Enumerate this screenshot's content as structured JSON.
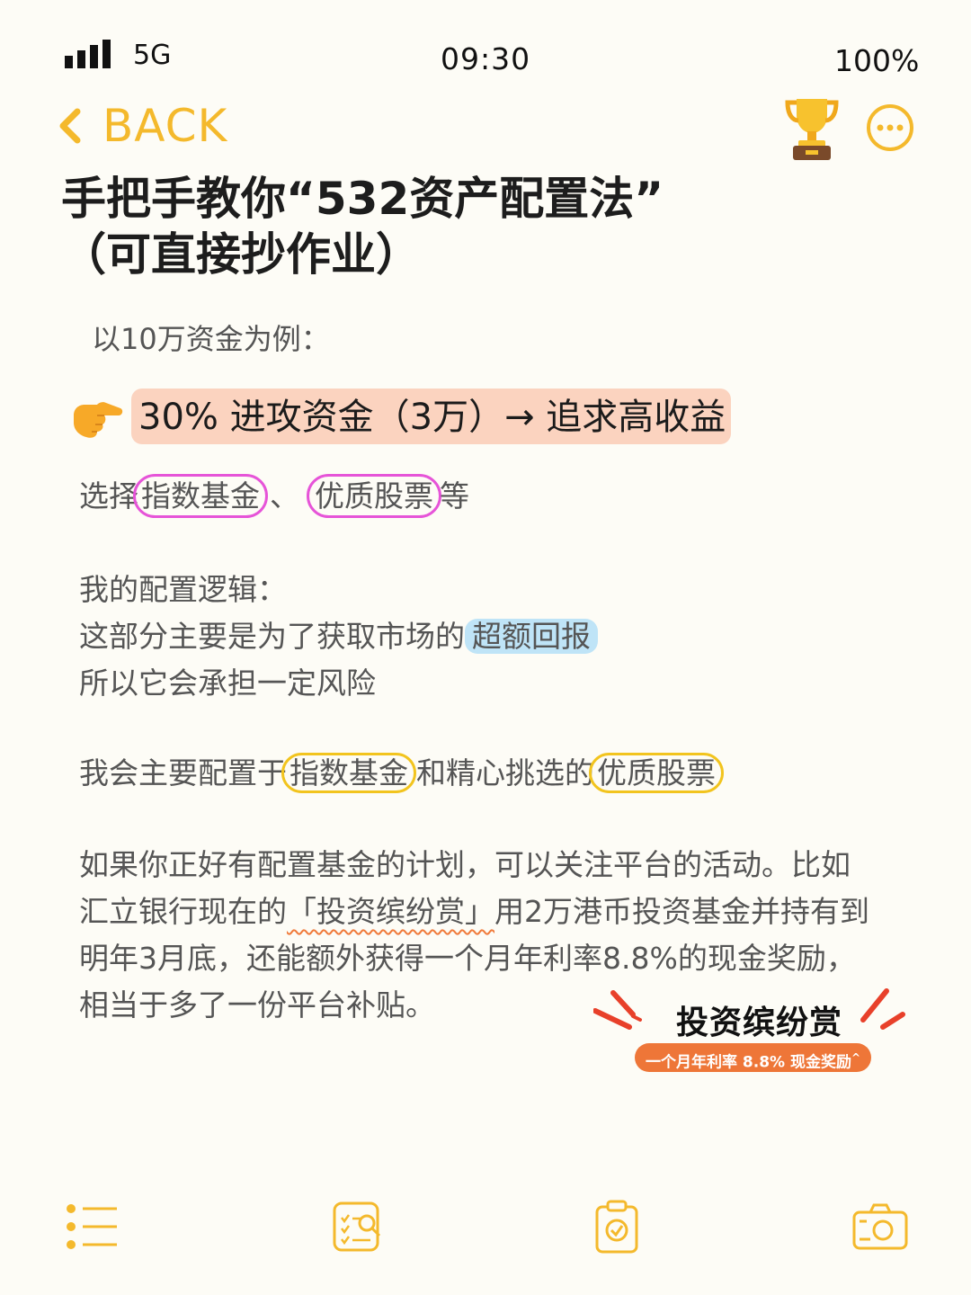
{
  "status_bar": {
    "network": "5G",
    "time": "09:30",
    "battery": "100%"
  },
  "nav": {
    "back_label": "BACK",
    "trophy_icon": "trophy-icon",
    "more_icon": "more-icon"
  },
  "title": {
    "line1": "手把手教你“532资产配置法”",
    "line2": "（可直接抄作业）"
  },
  "subtitle": "以10万资金为例：",
  "highlight": "30% 进攻资金（3万）→ 追求高收益",
  "choose_line": {
    "prefix": "选择",
    "item1": "指数基金",
    "sep": "、",
    "item2": "优质股票",
    "suffix": "等"
  },
  "logic": {
    "heading": "我的配置逻辑：",
    "line2_prefix": "这部分主要是为了获取市场的",
    "line2_hl": "超额回报",
    "line3": "所以它会承担一定风险"
  },
  "allocation": {
    "prefix": "我会主要配置于",
    "item1": "指数基金",
    "middle": "和精心挑选的",
    "item2": "优质股票"
  },
  "promo": {
    "p1": "如果你正好有配置基金的计划，可以关注平台的活动。比如",
    "p2_a": "汇立银行现在的",
    "p2_event": "「投资缤纷赏」",
    "p2_b": "用2万港币投资基金并持有到",
    "p3": "明年3月底，还能额外获得一个月年利率8.8%的现金奖励，",
    "p4": "相当于多了一份平台补贴。"
  },
  "badge": {
    "title": "投资缤纷赏",
    "pill": "一个月年利率 8.8% 现金奖励",
    "pill_mark": "^"
  },
  "colors": {
    "accent": "#f4b92c",
    "highlight_bg": "#fbd3bf",
    "pink_circle": "#e654d8",
    "yellow_circle": "#f2c41e",
    "blue_highlight": "#bfe4f7",
    "badge_orange": "#ee7638"
  },
  "bottom_tabs": [
    "list-icon",
    "checklist-search-icon",
    "clipboard-check-icon",
    "camera-icon"
  ]
}
